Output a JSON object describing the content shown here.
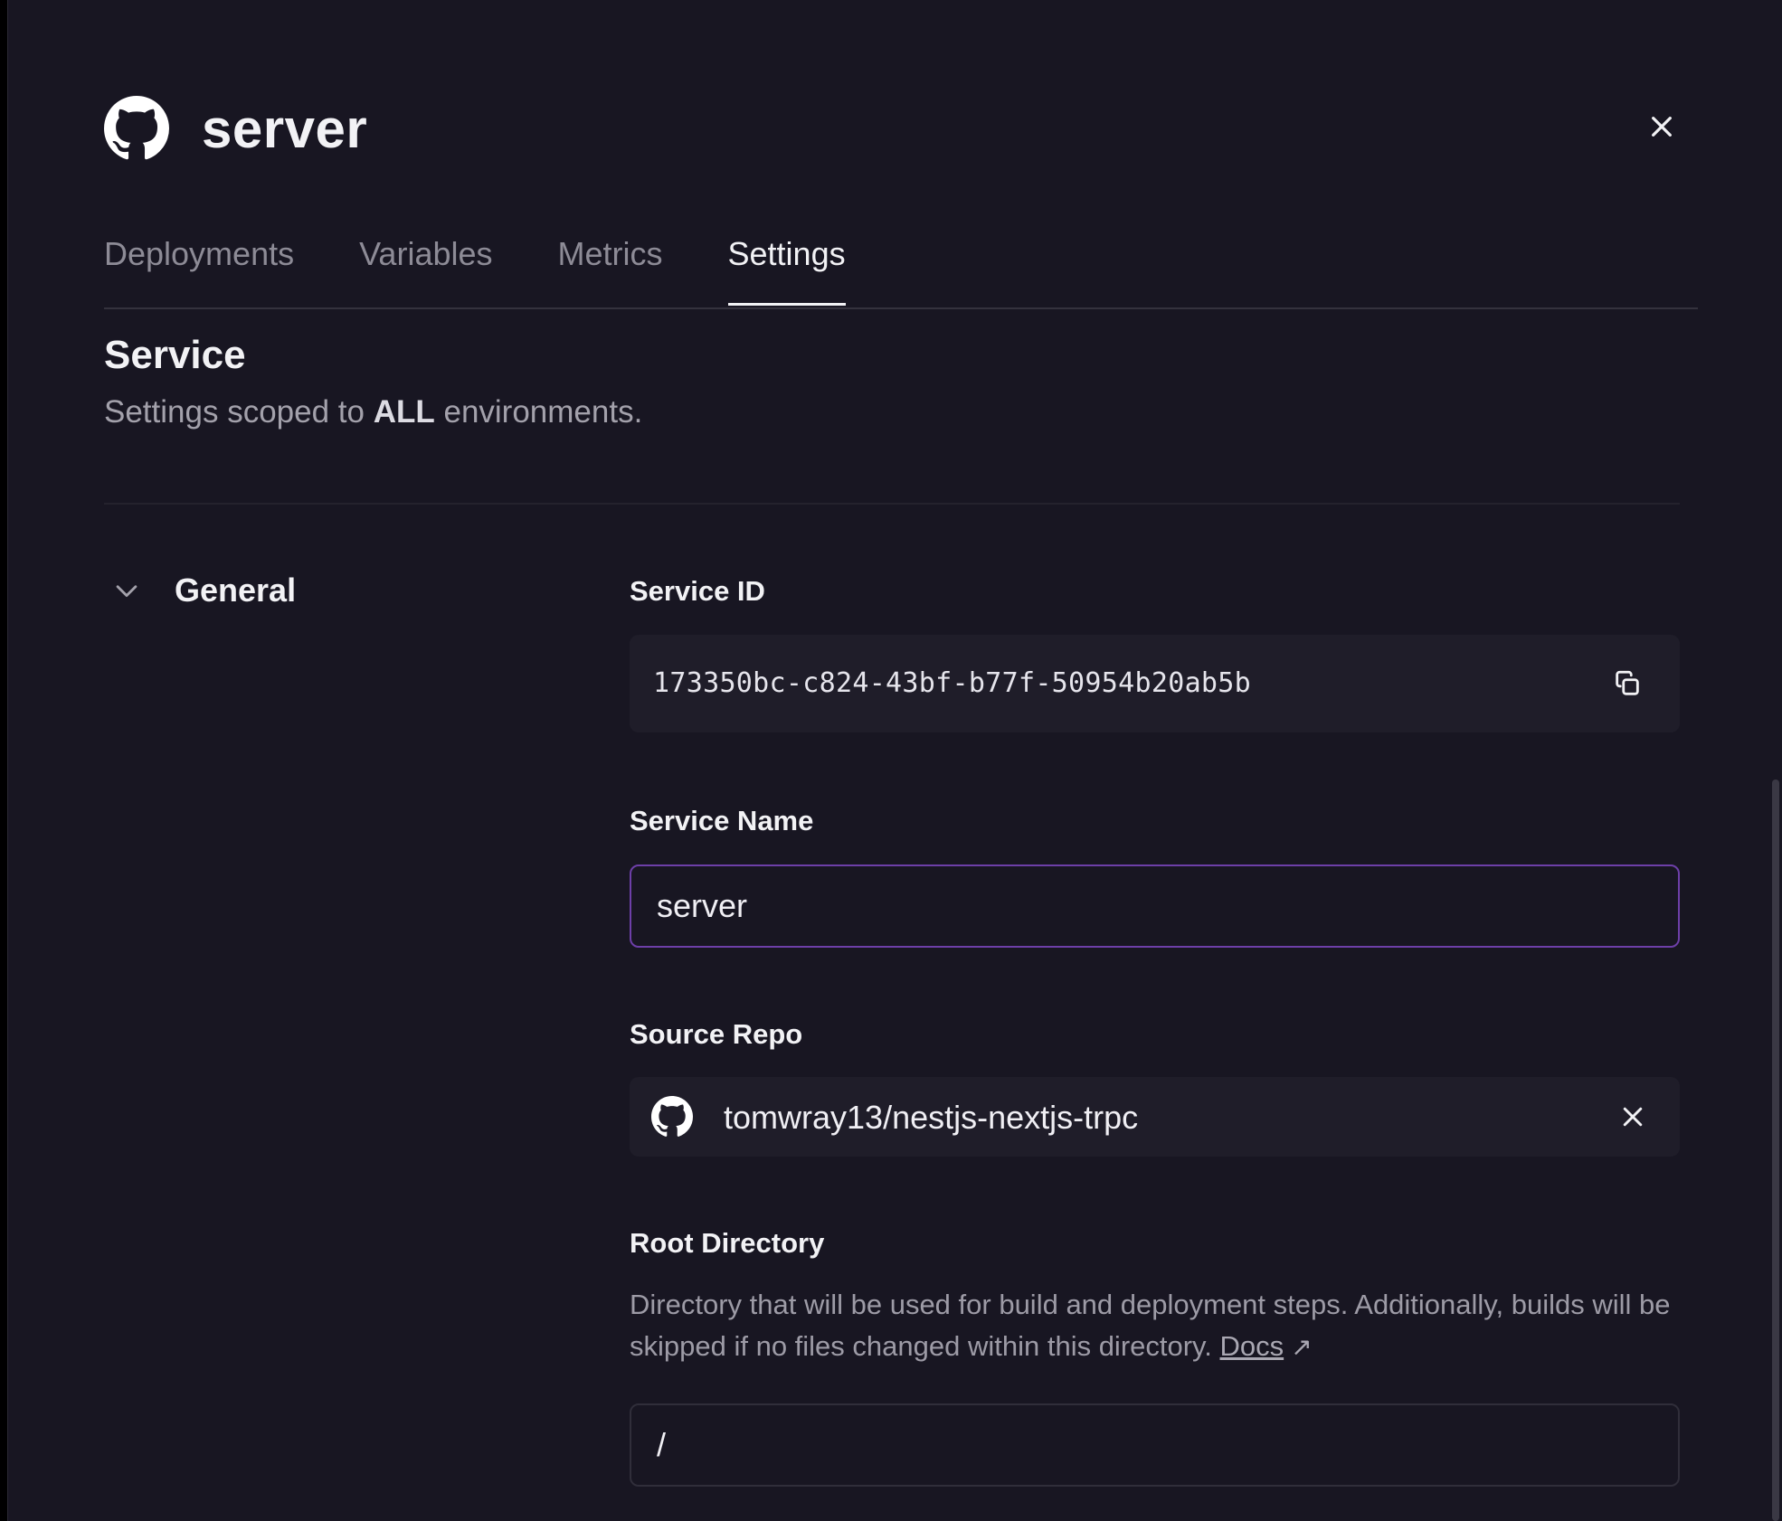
{
  "header": {
    "title": "server",
    "logo_icon": "github-icon",
    "close_icon": "close-icon"
  },
  "tabs": [
    {
      "label": "Deployments",
      "active": false
    },
    {
      "label": "Variables",
      "active": false
    },
    {
      "label": "Metrics",
      "active": false
    },
    {
      "label": "Settings",
      "active": true
    }
  ],
  "section": {
    "title": "Service",
    "subtitle_prefix": "Settings scoped to ",
    "subtitle_bold": "ALL",
    "subtitle_suffix": " environments."
  },
  "group": {
    "label": "General",
    "expanded": true,
    "toggle_icon": "chevron-down-icon"
  },
  "fields": {
    "service_id": {
      "label": "Service ID",
      "value": "173350bc-c824-43bf-b77f-50954b20ab5b",
      "copy_icon": "copy-icon"
    },
    "service_name": {
      "label": "Service Name",
      "value": "server"
    },
    "source_repo": {
      "label": "Source Repo",
      "value": "tomwray13/nestjs-nextjs-trpc",
      "icon": "github-icon",
      "remove_icon": "close-icon"
    },
    "root_directory": {
      "label": "Root Directory",
      "description": "Directory that will be used for build and deployment steps. Additionally, builds will be skipped if no files changed within this directory.",
      "docs_link": "Docs",
      "docs_arrow": "↗",
      "value": "/"
    }
  },
  "colors": {
    "background": "#181622",
    "input_focus_border": "#6d3fa8",
    "text_primary": "#f2f2f5",
    "text_muted": "#8d8b96"
  }
}
